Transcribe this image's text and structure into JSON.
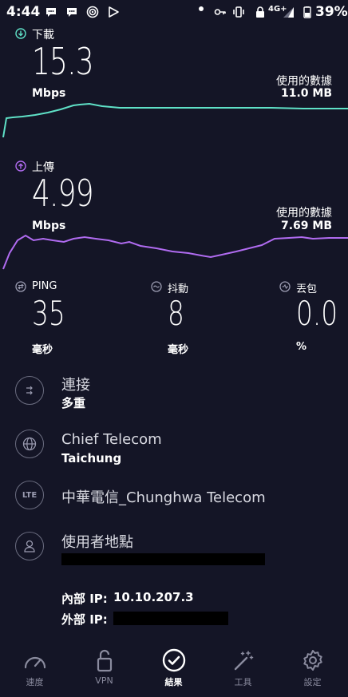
{
  "status_bar": {
    "time": "4:44",
    "network": "4G+",
    "battery": "39%"
  },
  "download": {
    "label": "下載",
    "value": "15.3",
    "unit": "Mbps",
    "data_used_label": "使用的數據",
    "data_used_value": "11.0 MB",
    "color": "#5fe1c7"
  },
  "upload": {
    "label": "上傳",
    "value": "4.99",
    "unit": "Mbps",
    "data_used_label": "使用的數據",
    "data_used_value": "7.69 MB",
    "color": "#b06bf0"
  },
  "metrics": {
    "ping": {
      "label": "PING",
      "value": "35",
      "unit": "毫秒"
    },
    "jitter": {
      "label": "抖動",
      "value": "8",
      "unit": "毫秒"
    },
    "loss": {
      "label": "丟包",
      "value": "0.0",
      "unit": "%"
    }
  },
  "connection": {
    "title": "連接",
    "value": "多重"
  },
  "server": {
    "title": "Chief Telecom",
    "value": "Taichung"
  },
  "provider": {
    "badge": "LTE",
    "title": "中華電信_Chunghwa Telecom"
  },
  "location": {
    "title": "使用者地點"
  },
  "ip": {
    "internal_label": "內部 IP:",
    "internal_value": "10.10.207.3",
    "external_label": "外部 IP:"
  },
  "nav": {
    "items": [
      "速度",
      "VPN",
      "結果",
      "工具",
      "設定"
    ],
    "active": "結果"
  }
}
